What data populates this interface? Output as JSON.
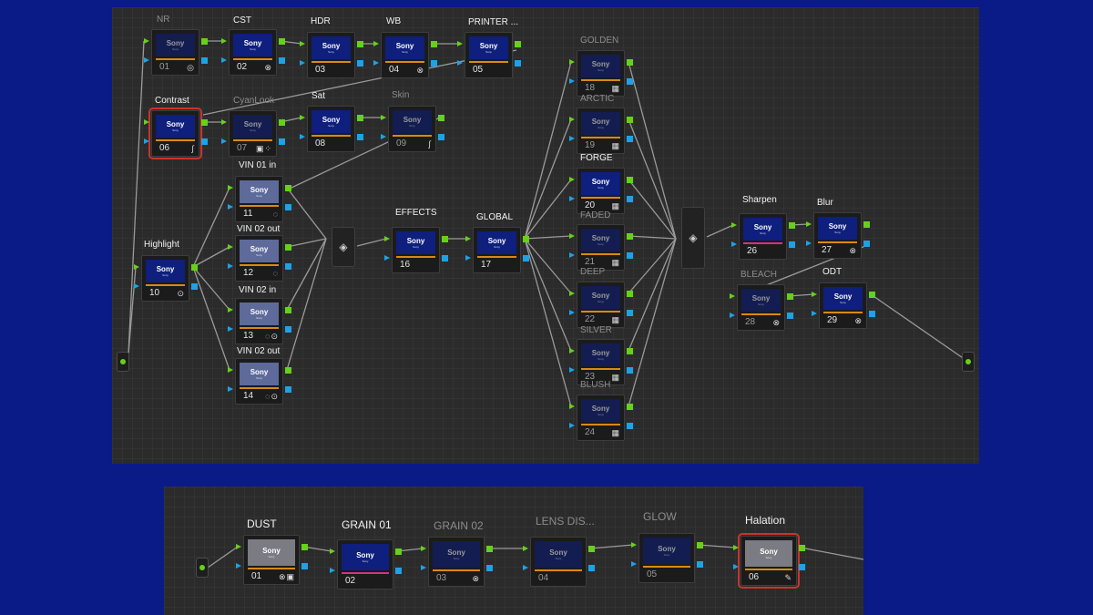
{
  "brand": "Sony",
  "brand_sub": "Sony",
  "main_graph": {
    "nodes": [
      {
        "num": "01",
        "label": "NR",
        "tools": "◎",
        "dim": true
      },
      {
        "num": "02",
        "label": "CST",
        "tools": "⊗"
      },
      {
        "num": "03",
        "label": "HDR",
        "tools": ""
      },
      {
        "num": "04",
        "label": "WB",
        "tools": "⊗"
      },
      {
        "num": "05",
        "label": "PRINTER ...",
        "tools": ""
      },
      {
        "num": "06",
        "label": "Contrast",
        "tools": "∫"
      },
      {
        "num": "07",
        "label": "CyanLook",
        "tools": "▣⁘",
        "dim": true
      },
      {
        "num": "08",
        "label": "Sat",
        "tools": ""
      },
      {
        "num": "09",
        "label": "Skin",
        "tools": "∫",
        "dim": true
      },
      {
        "num": "10",
        "label": "Highlight",
        "tools": "⊙"
      },
      {
        "num": "11",
        "label": "VIN 01 in",
        "tools": "◌"
      },
      {
        "num": "12",
        "label": "VIN 02 out",
        "tools": "◌"
      },
      {
        "num": "13",
        "label": "VIN 02 in",
        "tools": "◌⊙"
      },
      {
        "num": "14",
        "label": "VIN 02 out",
        "tools": "◌⊙"
      },
      {
        "num": "16",
        "label": "EFFECTS",
        "tools": ""
      },
      {
        "num": "17",
        "label": "GLOBAL",
        "tools": ""
      },
      {
        "num": "18",
        "label": "GOLDEN",
        "tools": "▦",
        "dim": true
      },
      {
        "num": "19",
        "label": "ARCTIC",
        "tools": "▦",
        "dim": true
      },
      {
        "num": "20",
        "label": "FORGE",
        "tools": "▦"
      },
      {
        "num": "21",
        "label": "FADED",
        "tools": "▦",
        "dim": true
      },
      {
        "num": "22",
        "label": "DEEP",
        "tools": "▦",
        "dim": true
      },
      {
        "num": "23",
        "label": "SILVER",
        "tools": "▦",
        "dim": true
      },
      {
        "num": "24",
        "label": "BLUSH",
        "tools": "▦",
        "dim": true
      },
      {
        "num": "26",
        "label": "Sharpen",
        "tools": ""
      },
      {
        "num": "27",
        "label": "Blur",
        "tools": "⊗"
      },
      {
        "num": "28",
        "label": "BLEACH",
        "tools": "⊗",
        "dim": true
      },
      {
        "num": "29",
        "label": "ODT",
        "tools": "⊗"
      }
    ]
  },
  "fx_graph": {
    "nodes": [
      {
        "num": "01",
        "label": "DUST",
        "tools": "⊗▣"
      },
      {
        "num": "02",
        "label": "GRAIN 01",
        "tools": ""
      },
      {
        "num": "03",
        "label": "GRAIN 02",
        "tools": "⊗",
        "dim": true
      },
      {
        "num": "04",
        "label": "LENS DIS...",
        "tools": "",
        "dim": true
      },
      {
        "num": "05",
        "label": "GLOW",
        "tools": "",
        "dim": true
      },
      {
        "num": "06",
        "label": "Halation",
        "tools": "✎"
      }
    ]
  },
  "colors": {
    "background": "#0a1a86",
    "panel": "#2b2b2b",
    "rgb_pin": "#66d11a",
    "alpha_pin": "#1ea2e6",
    "bar": "#d88a13",
    "selected": "#c8342c"
  },
  "icons": [
    "layer-mixer-icon",
    "curve-icon",
    "grid-icon",
    "circle-window-icon",
    "hdr-icon",
    "fx-icon",
    "pen-icon"
  ]
}
